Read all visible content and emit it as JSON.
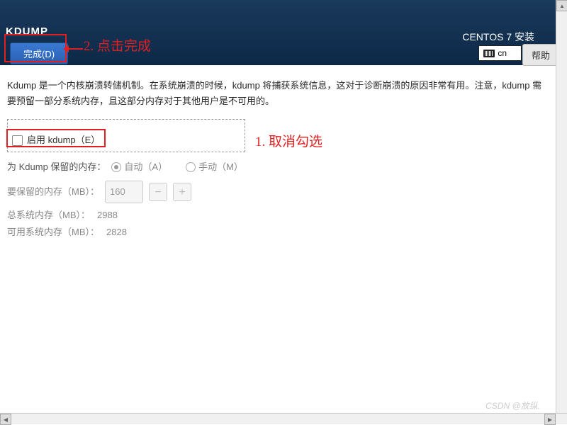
{
  "header": {
    "title": "KDUMP",
    "done_button": "完成(D)",
    "install_title": "CENTOS 7 安装",
    "lang_code": "cn",
    "help_button": "帮助"
  },
  "annotations": {
    "step1": "1. 取消勾选",
    "step2": "2. 点击完成"
  },
  "body": {
    "description": "Kdump 是一个内核崩溃转储机制。在系统崩溃的时候，kdump 将捕获系统信息，这对于诊断崩溃的原因非常有用。注意，kdump 需要预留一部分系统内存，且这部分内存对于其他用户是不可用的。",
    "enable_label": "启用 kdump（E）",
    "reserved_label": "为 Kdump 保留的内存：",
    "auto_label": "自动（A）",
    "manual_label": "手动（M）",
    "to_reserve_label": "要保留的内存（MB）：",
    "to_reserve_value": "160",
    "total_label": "总系统内存（MB）：",
    "total_value": "2988",
    "avail_label": "可用系统内存（MB）：",
    "avail_value": "2828"
  },
  "watermark": "CSDN @放纵."
}
